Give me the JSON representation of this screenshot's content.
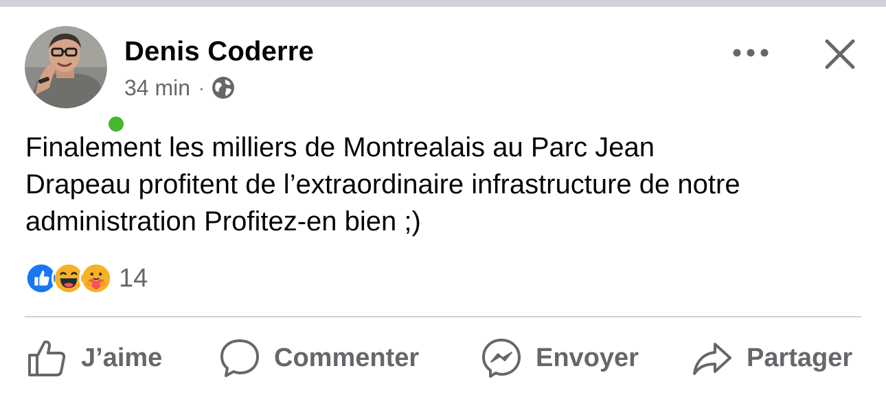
{
  "post": {
    "author": "Denis Coderre",
    "time": "34 min",
    "separator": "·",
    "audience_icon": "globe-icon",
    "text": "Finalement les milliers de Montrealais au Parc Jean\nDrapeau profitent de l’extraordinaire infrastructure de notre\nadministration Profitez-en bien ;)",
    "status": "online"
  },
  "reactions": {
    "types": [
      "like",
      "haha",
      "care"
    ],
    "count": "14"
  },
  "actions": {
    "like": "J’aime",
    "comment": "Commenter",
    "send": "Envoyer",
    "share": "Partager"
  },
  "icons": {
    "more": "more-options-icon",
    "close": "close-icon",
    "like": "thumbs-up-icon",
    "comment": "comment-bubble-icon",
    "send": "messenger-icon",
    "share": "share-arrow-icon"
  },
  "colors": {
    "text": "#050505",
    "muted": "#65676b",
    "online": "#44b72d",
    "like_blue": "#1877f2",
    "divider": "#ced0d4"
  }
}
